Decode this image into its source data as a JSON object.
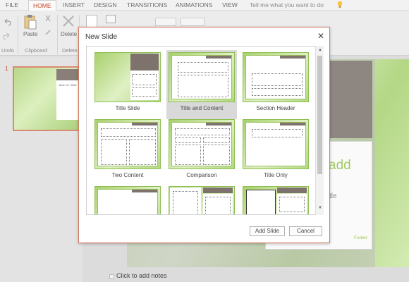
{
  "ribbon": {
    "tabs": [
      "FILE",
      "HOME",
      "INSERT",
      "DESIGN",
      "TRANSITIONS",
      "ANIMATIONS",
      "VIEW"
    ],
    "tell_me": "Tell me what you want to do",
    "groups": [
      "Undo",
      "Clipboard",
      "Delete"
    ],
    "paste_label": "Paste",
    "delete_label": "Delete"
  },
  "thumbnails": {
    "slide_number": "1",
    "thumb_text": "June 13, 2016"
  },
  "slide": {
    "big_text": "add",
    "sub_text": "tle",
    "footer": "Footer"
  },
  "notes": {
    "placeholder": "Click to add notes"
  },
  "dialog": {
    "title": "New Slide",
    "close": "✕",
    "layouts": [
      {
        "name": "Title Slide"
      },
      {
        "name": "Title and Content",
        "selected": true
      },
      {
        "name": "Section Header"
      },
      {
        "name": "Two Content"
      },
      {
        "name": "Comparison"
      },
      {
        "name": "Title Only"
      }
    ],
    "add_button": "Add Slide",
    "cancel_button": "Cancel"
  },
  "colors": {
    "accent": "#c5472a",
    "layout_green": "#a9d16d",
    "photo_gray": "#8e8681"
  }
}
